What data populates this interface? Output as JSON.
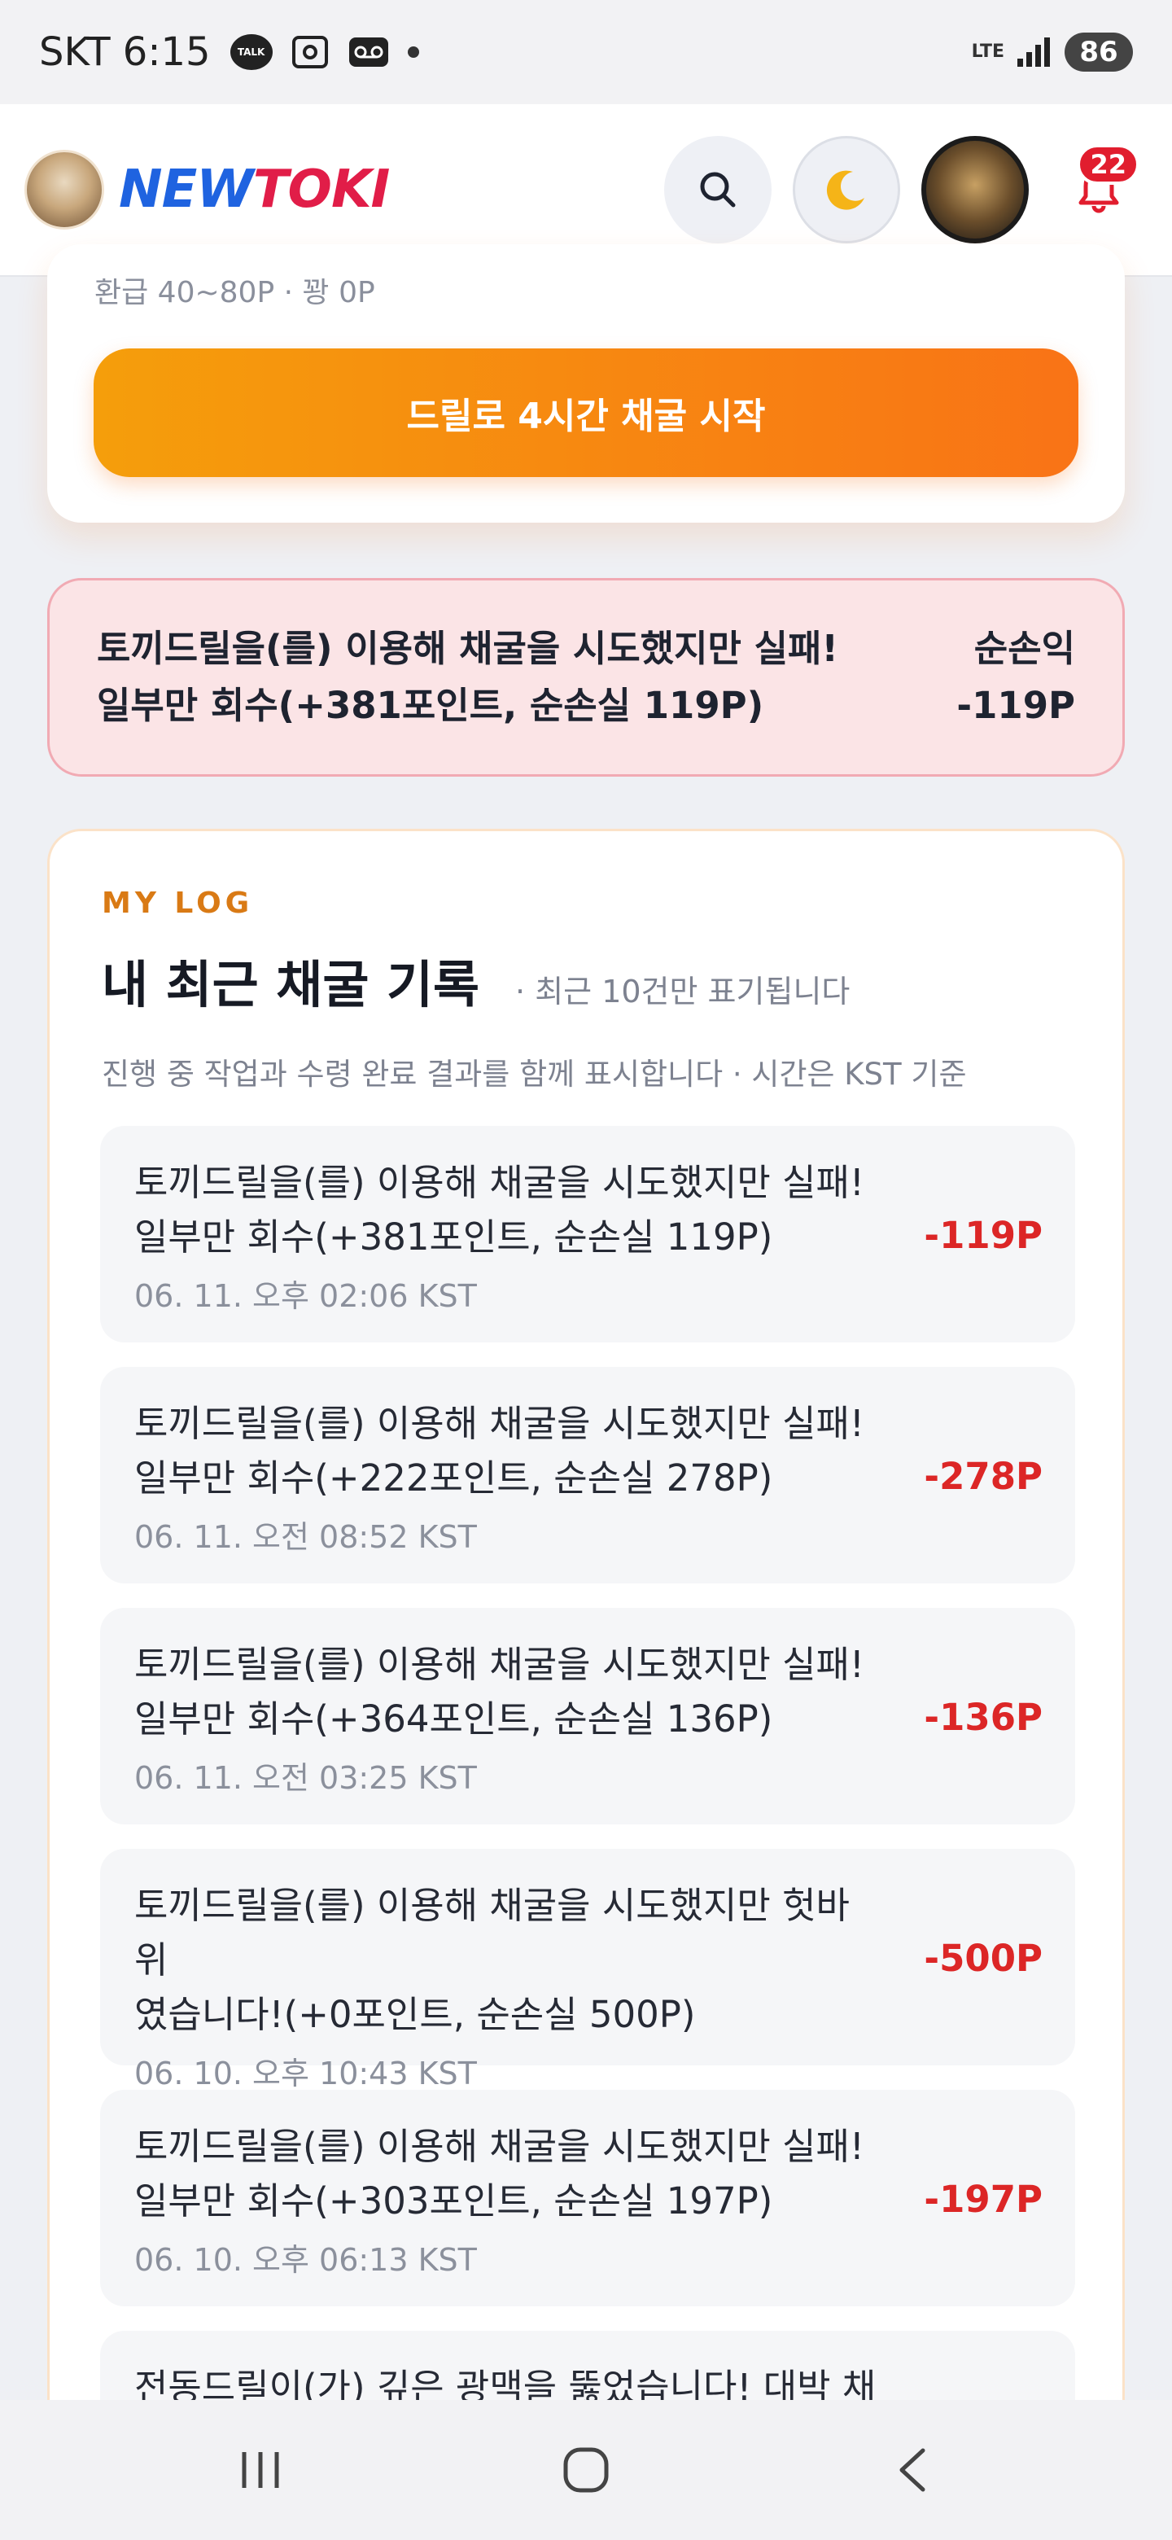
{
  "status_bar": {
    "carrier_time": "SKT 6:15",
    "talk_label": "TALK",
    "network": "LTE",
    "battery": "86",
    "icons": [
      "talk-icon",
      "screenshot-icon",
      "voicemail-icon",
      "dot-icon",
      "signal-icon"
    ]
  },
  "header": {
    "logo_part1": "NEW",
    "logo_part2": "TOKI",
    "notification_count": "22",
    "icons": [
      "search-icon",
      "moon-icon",
      "bell-icon"
    ]
  },
  "drill_card": {
    "meta_text": "환급 40~80P · 꽝 0P",
    "start_button": "드릴로 4시간 채굴 시작"
  },
  "result_banner": {
    "line1": "토끼드릴을(를) 이용해 채굴을 시도했지만 실패!",
    "line2": "일부만 회수(+381포인트, 순손실 119P)",
    "net_label": "순손익",
    "net_value": "-119P"
  },
  "log": {
    "eyebrow": "MY LOG",
    "title": "내 최근 채굴 기록",
    "title_note": "· 최근 10건만 표기됩니다",
    "description": "진행 중 작업과 수령 완료 결과를 함께 표시합니다 · 시간은 KST 기준",
    "entries": [
      {
        "line1": "토끼드릴을(를) 이용해 채굴을 시도했지만 실패!",
        "line2": "일부만 회수(+381포인트, 순손실 119P)",
        "time": "06. 11. 오후 02:06 KST",
        "amount": "-119P"
      },
      {
        "line1": "토끼드릴을(를) 이용해 채굴을 시도했지만 실패!",
        "line2": "일부만 회수(+222포인트, 순손실 278P)",
        "time": "06. 11. 오전 08:52 KST",
        "amount": "-278P"
      },
      {
        "line1": "토끼드릴을(를) 이용해 채굴을 시도했지만 실패!",
        "line2": "일부만 회수(+364포인트, 순손실 136P)",
        "time": "06. 11. 오전 03:25 KST",
        "amount": "-136P"
      },
      {
        "line1": "토끼드릴을(를) 이용해 채굴을 시도했지만 헛바위",
        "line2": "였습니다!(+0포인트, 순손실 500P)",
        "time": "06. 10. 오후 10:43 KST",
        "amount": "-500P"
      },
      {
        "line1": "토끼드릴을(를) 이용해 채굴을 시도했지만 실패!",
        "line2": "일부만 회수(+303포인트, 순손실 197P)",
        "time": "06. 10. 오후 06:13 KST",
        "amount": "-197P"
      },
      {
        "line1": "전동드릴이(가) 깊은 광맥을 뚫었습니다! 대박 채",
        "line2": "",
        "time": "",
        "amount": ""
      }
    ]
  },
  "nav_bar": {
    "icons": [
      "recent-apps-icon",
      "home-icon",
      "back-icon"
    ]
  },
  "colors": {
    "brand_blue": "#1f63e0",
    "brand_red": "#e11d48",
    "accent_orange": "#f97316",
    "loss_red": "#dc2626",
    "eyebrow_orange": "#d97a15"
  }
}
